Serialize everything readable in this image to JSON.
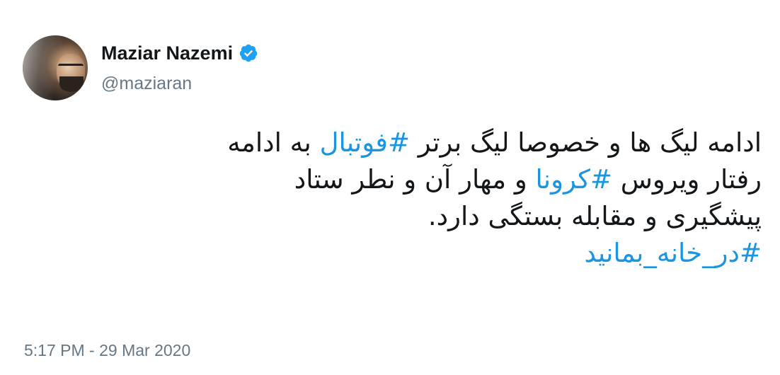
{
  "author": {
    "display_name": "Maziar Nazemi",
    "handle": "@maziaran",
    "verified": true,
    "avatar_icon": "profile-photo",
    "verified_icon": "verified-badge-icon"
  },
  "tweet": {
    "line1": {
      "pre": "ادامه لیگ ها و خصوصا لیگ برتر ",
      "hashtag": "#فوتبال",
      "post": " به ادامه"
    },
    "line2": {
      "pre": "رفتار ویروس ",
      "hashtag": "#کرونا",
      "post": " و مهار آن  و نطر ستاد"
    },
    "line3": "پیشگیری و مقابله بستگی دارد.",
    "line4_hashtag": "#در_خانه_بمانید"
  },
  "timestamp": "5:17 PM - 29 Mar 2020",
  "colors": {
    "text": "#14171a",
    "secondary": "#657786",
    "link": "#1b95e0",
    "verified": "#1da1f2"
  }
}
